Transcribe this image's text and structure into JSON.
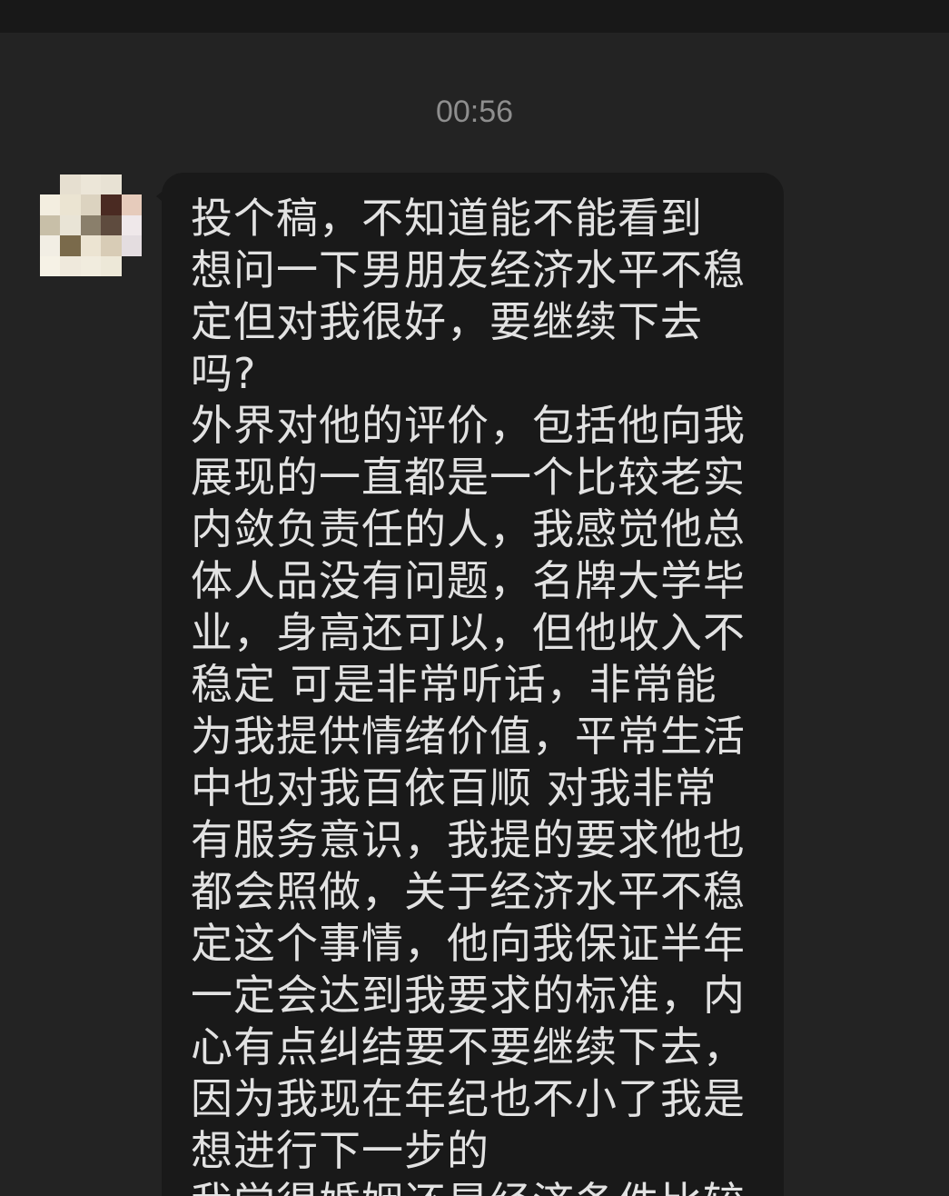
{
  "header": {
    "timestamp": "00:56"
  },
  "avatar": {
    "pixels": [
      [
        "#232323",
        "#e6dfd0",
        "#ece6d8",
        "#e8e2d4",
        "#232323"
      ],
      [
        "#f3eee0",
        "#ebe4d2",
        "#dcd3c0",
        "#4a2a22",
        "#e6cbbb"
      ],
      [
        "#c8bfa8",
        "#e9e4d6",
        "#8a7f6b",
        "#5e4b3e",
        "#efe8ea"
      ],
      [
        "#f2eee4",
        "#7a6a4b",
        "#ece4d2",
        "#d8ccb6",
        "#e4dde0"
      ],
      [
        "#f6f2e6",
        "#efe9dc",
        "#f1ecde",
        "#ede8d8",
        "#232323"
      ]
    ]
  },
  "message": {
    "lines": [
      "投个稿，不知道能不能看到",
      "想问一下男朋友经济水平不稳",
      "定但对我很好，要继续下去",
      "吗?",
      "外界对他的评价，包括他向我",
      "展现的一直都是一个比较老实",
      "内敛负责任的人，我感觉他总",
      "体人品没有问题，名牌大学毕",
      "业，身高还可以，但他收入不",
      "稳定 可是非常听话，非常能",
      "为我提供情绪价值，平常生活",
      "中也对我百依百顺 对我非常",
      "有服务意识，我提的要求他也",
      "都会照做，关于经济水平不稳",
      "定这个事情，他向我保证半年",
      "一定会达到我要求的标准，内",
      "心有点纠结要不要继续下去，",
      "因为我现在年纪也不小了我是",
      "想进行下一步的",
      "我觉得婚姻还是经济条件比较"
    ]
  }
}
